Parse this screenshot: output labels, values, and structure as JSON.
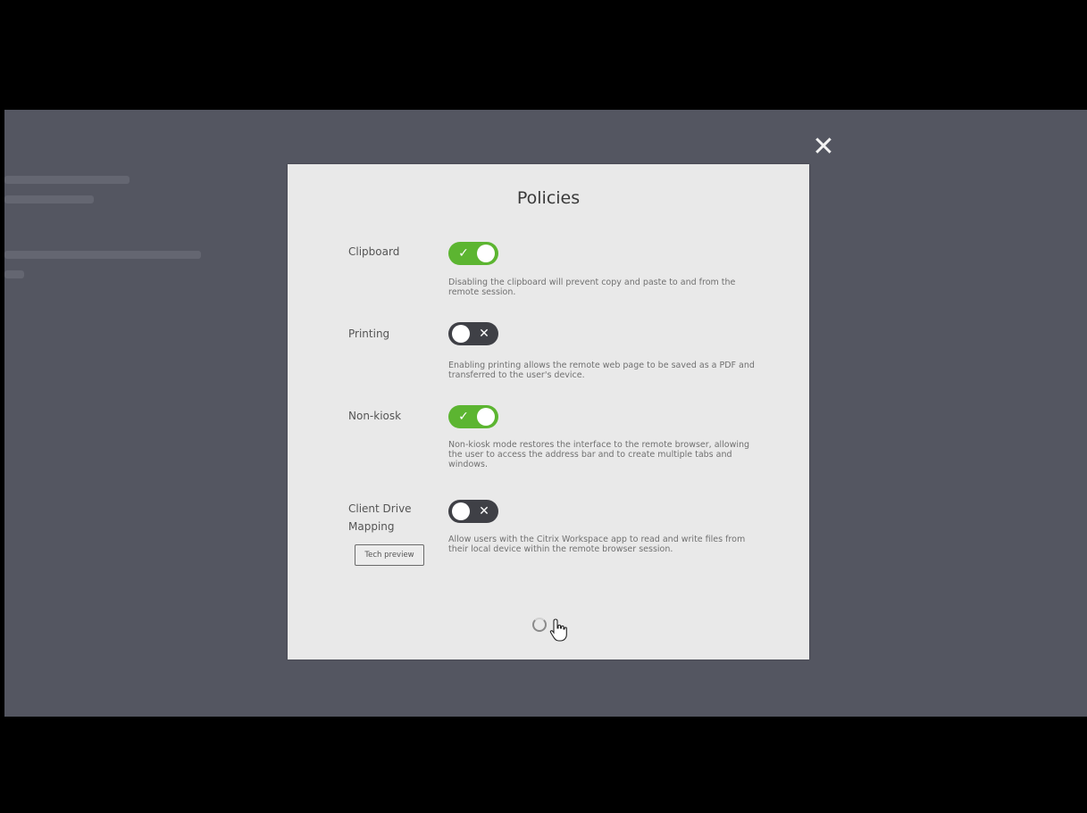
{
  "modal": {
    "title": "Policies",
    "close_label": "✕"
  },
  "policies": [
    {
      "label": "Clipboard",
      "enabled": true,
      "description": "Disabling the clipboard will prevent copy and paste to and from the remote session."
    },
    {
      "label": "Printing",
      "enabled": false,
      "description": "Enabling printing allows the remote web page to be saved as a PDF and transferred to the user's device."
    },
    {
      "label": "Non-kiosk",
      "enabled": true,
      "description": "Non-kiosk mode restores the interface to the remote browser, allowing the user to access the address bar and to create multiple tabs and windows."
    },
    {
      "label": "Client Drive Mapping",
      "enabled": false,
      "badge": "Tech preview",
      "description": "Allow users with the Citrix Workspace app to read and write files from their local device within the remote browser session."
    }
  ],
  "toggle_marks": {
    "on": "✓",
    "off": "✕"
  },
  "colors": {
    "toggle_on": "#5cb531",
    "toggle_off": "#3f4046",
    "overlay": "#545661",
    "modal_bg": "#e9e9e9"
  }
}
